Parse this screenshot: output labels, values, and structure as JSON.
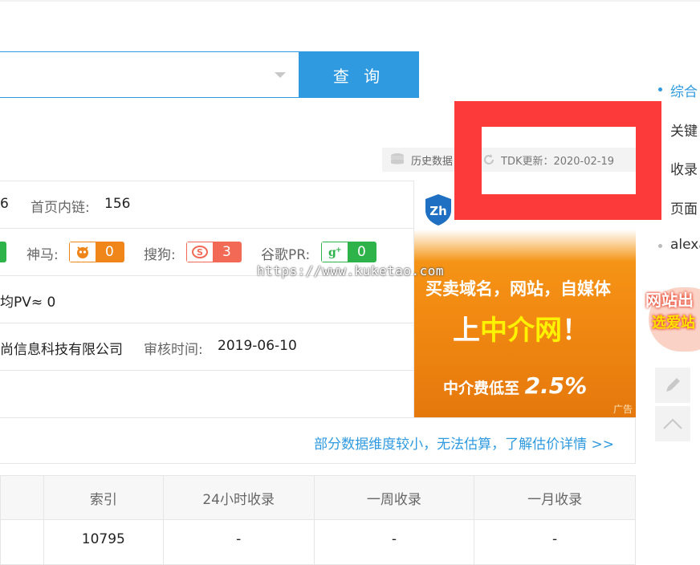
{
  "search": {
    "value": "",
    "query_label": "查 询"
  },
  "right_nav": {
    "items": [
      {
        "label": "综合",
        "active": true
      },
      {
        "label": "关键",
        "active": false
      },
      {
        "label": "收录",
        "active": false
      },
      {
        "label": "页面",
        "active": false
      },
      {
        "label": "alexa",
        "active": false
      }
    ]
  },
  "history": {
    "label": "历史数据"
  },
  "tdk": {
    "label": "TDK更新：2020-02-19"
  },
  "info": {
    "row1": {
      "prefix": "6",
      "inner_links_label": "首页内链:",
      "inner_links_value": "156"
    },
    "row2": {
      "shenma_label": "神马:",
      "shenma_value": "0",
      "sogou_label": "搜狗:",
      "sogou_value": "3",
      "google_label": "谷歌PR:",
      "google_value": "0"
    },
    "row3": {
      "text": "均PV≈ 0"
    },
    "row4": {
      "company": "尚信息科技有限公司",
      "audit_label": "审核时间:",
      "audit_value": "2019-06-10"
    }
  },
  "ad": {
    "line1": "买卖域名，网站，自媒体",
    "line2_prefix": "上",
    "line2_highlight": "中介网",
    "line2_suffix": "！",
    "line3_prefix": "中介费低至",
    "line3_value": "2.5%",
    "tag": "广告"
  },
  "watermark": "https://www.kuketao.com",
  "side_promo": {
    "line1": "网站出",
    "line2": "选爱站"
  },
  "estimate": {
    "link": "部分数据维度较小，无法估算，了解估价详情 >>"
  },
  "table": {
    "headers": [
      "",
      "索引",
      "24小时收录",
      "一周收录",
      "一月收录"
    ],
    "rows": [
      [
        "",
        "10795",
        "-",
        "-",
        "-"
      ]
    ]
  },
  "colors": {
    "accent": "#2f9ae0",
    "overlay_red": "#fc3a3a",
    "ad_orange": "#f28a12",
    "shenma": "#f08519",
    "sogou": "#f26a56",
    "google": "#2db34a"
  }
}
